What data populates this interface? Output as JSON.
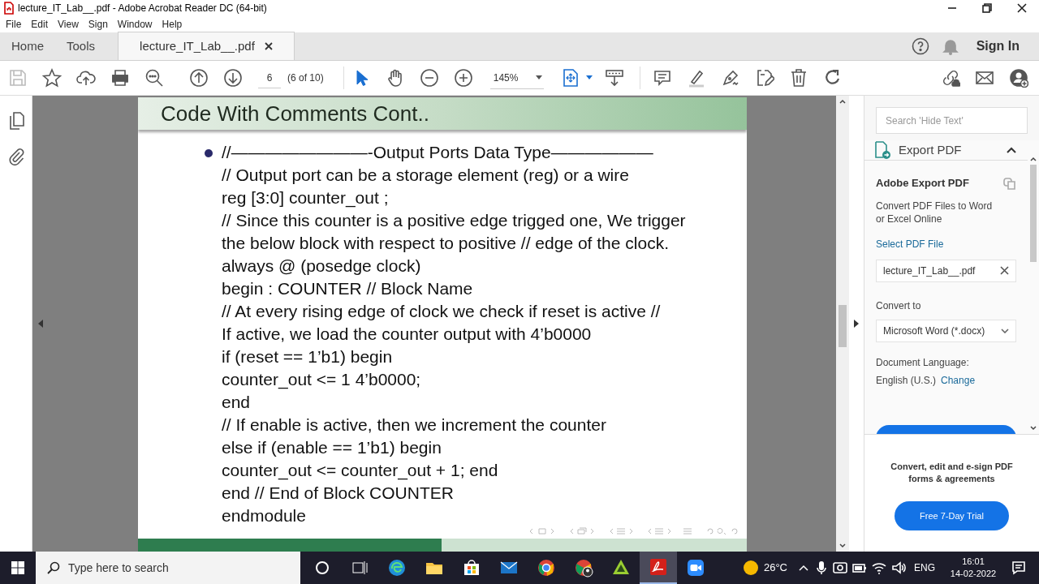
{
  "window": {
    "title": "lecture_IT_Lab__.pdf - Adobe Acrobat Reader DC (64-bit)"
  },
  "menu": [
    "File",
    "Edit",
    "View",
    "Sign",
    "Window",
    "Help"
  ],
  "tabs": [
    {
      "label": "Home",
      "selected": false
    },
    {
      "label": "Tools",
      "selected": false
    },
    {
      "label": "lecture_IT_Lab__.pdf",
      "selected": true
    }
  ],
  "sign_in": "Sign In",
  "toolbar": {
    "page": "6",
    "page_count": "(6 of 10)",
    "zoom": "145%"
  },
  "slide": {
    "title": "Code With Comments Cont..",
    "lines": [
      "//————————-Output Ports Data Type——————",
      "// Output port can be a storage element (reg) or a wire",
      "reg [3:0] counter_out ;",
      "// Since this counter is a positive edge trigged one, We trigger",
      "the below block with respect to positive // edge of the clock.",
      "always @ (posedge clock)",
      "begin : COUNTER // Block Name",
      "// At every rising edge of clock we check if reset is active //",
      "If active, we load the counter output with 4’b0000",
      "if (reset == 1’b1) begin",
      "counter_out <= 1 4’b0000;",
      "end",
      "// If enable is active, then we increment the counter",
      "else if (enable == 1’b1) begin",
      "counter_out <= counter_out + 1; end",
      "end // End of Block COUNTER",
      "endmodule"
    ]
  },
  "panel": {
    "search_placeholder": "Search 'Hide Text'",
    "section": "Export PDF",
    "expanded": true,
    "heading": "Adobe Export PDF",
    "description": "Convert PDF Files to Word or Excel Online",
    "select_label": "Select PDF File",
    "file": "lecture_IT_Lab__.pdf",
    "convert_label": "Convert to",
    "format": "Microsoft Word (*.docx)",
    "language_label": "Document Language:",
    "language": "English (U.S.)",
    "change": "Change",
    "promo": "Convert, edit and e-sign PDF forms & agreements",
    "trial": "Free 7-Day Trial"
  },
  "taskbar": {
    "search_placeholder": "Type here to search",
    "apps": [
      {
        "kind": "cortana",
        "selected": false
      },
      {
        "kind": "taskview",
        "selected": false
      },
      {
        "kind": "edge",
        "selected": false
      },
      {
        "kind": "explorer",
        "selected": false
      },
      {
        "kind": "store",
        "selected": false
      },
      {
        "kind": "mail",
        "selected": false
      },
      {
        "kind": "chrome",
        "selected": false
      },
      {
        "kind": "chrome_profile",
        "selected": false
      },
      {
        "kind": "triangle_app",
        "selected": false
      },
      {
        "kind": "acrobat",
        "selected": true
      },
      {
        "kind": "zoom",
        "selected": false
      }
    ],
    "temperature": "26°C",
    "language": "ENG",
    "time": "16:01",
    "date": "14-02-2022"
  }
}
